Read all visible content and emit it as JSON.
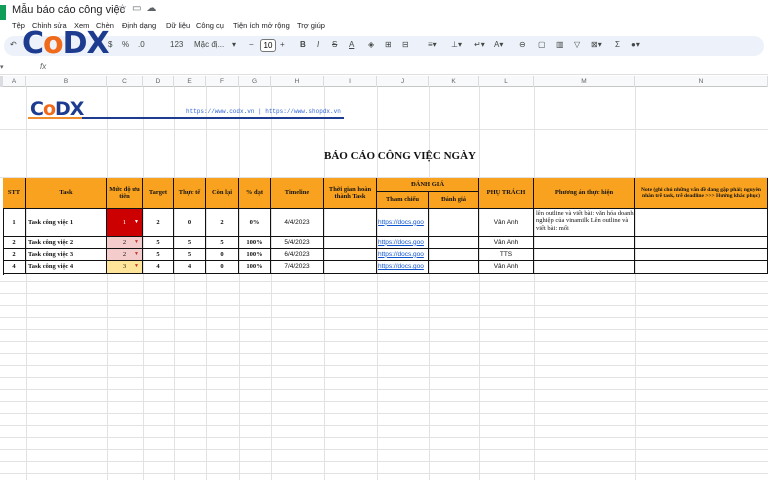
{
  "app": {
    "doc_title": "Mẫu báo cáo công việc",
    "title_icons": [
      "star-icon",
      "move-to-folder-icon",
      "cloud-status-icon"
    ]
  },
  "menu": [
    "Tệp",
    "Chỉnh sửa",
    "Xem",
    "Chèn",
    "Định dạng",
    "Dữ liệu",
    "Công cụ",
    "Tiện ích mở rộng",
    "Trợ giúp"
  ],
  "toolbar": {
    "percent": "%",
    "decimal": ".0",
    "number_format": "123",
    "font_name": "Mặc đị...",
    "font_size": "10",
    "minus": "−",
    "plus": "+",
    "bold": "B",
    "italic": "I",
    "strike": "S",
    "text_color": "A"
  },
  "formula": {
    "cell_ref": "▾",
    "fx": "fx"
  },
  "columns": [
    "A",
    "B",
    "C",
    "D",
    "E",
    "F",
    "G",
    "H",
    "I",
    "J",
    "K",
    "L",
    "M",
    "N"
  ],
  "brand": {
    "logo_c": "C",
    "logo_o": "o",
    "logo_dx": "DX",
    "links": "https://www.codx.vn  |  https://www.shopdx.vn",
    "blue": "#1d3c8f",
    "orange": "#f06a1c"
  },
  "report": {
    "title": "BÁO CÁO CÔNG VIỆC NGÀY",
    "headers": {
      "stt": "STT",
      "task": "Task",
      "priority": "Mức độ ưu tiên",
      "target": "Target",
      "actual": "Thực tế",
      "remaining": "Còn lại",
      "percent": "% đạt",
      "timeline": "Timeline",
      "done_time": "Thời gian hoàn thành Task",
      "review": "ĐÁNH GIÁ",
      "reference": "Tham chiếu",
      "rating": "Đánh giá",
      "owner": "PHỤ TRÁCH",
      "plan": "Phương án thực hiện",
      "note": "Note (ghi chú những vấn đề đang gặp phải; nguyên nhân trễ task, trễ deadline >>> Hướng khắc phục)"
    },
    "header_color": "#f9a21f",
    "rows": [
      {
        "stt": "1",
        "task": "Task công việc 1",
        "priority": "1",
        "target": "2",
        "actual": "0",
        "remaining": "2",
        "percent": "0%",
        "timeline": "4/4/2023",
        "done": "",
        "reference": "https://docs.goo",
        "rating": "",
        "owner": "Vân Anh",
        "plan": "lên outline và viết bài: văn hóa doanh nghiệp của vinamilk Lên outline và viết bài: mối",
        "note": ""
      },
      {
        "stt": "2",
        "task": "Task công việc 2",
        "priority": "2",
        "target": "5",
        "actual": "5",
        "remaining": "5",
        "percent": "100%",
        "timeline": "5/4/2023",
        "done": "",
        "reference": "https://docs.goo",
        "rating": "",
        "owner": "Vân Anh",
        "plan": "",
        "note": ""
      },
      {
        "stt": "2",
        "task": "Task công việc 3",
        "priority": "2",
        "target": "5",
        "actual": "5",
        "remaining": "0",
        "percent": "100%",
        "timeline": "6/4/2023",
        "done": "",
        "reference": "https://docs.goo",
        "rating": "",
        "owner": "TTS",
        "plan": "",
        "note": ""
      },
      {
        "stt": "4",
        "task": "Task công việc 4",
        "priority": "3",
        "target": "4",
        "actual": "4",
        "remaining": "0",
        "percent": "100%",
        "timeline": "7/4/2023",
        "done": "",
        "reference": "https://docs.goo",
        "rating": "",
        "owner": "Vân Anh",
        "plan": "",
        "note": ""
      }
    ]
  }
}
